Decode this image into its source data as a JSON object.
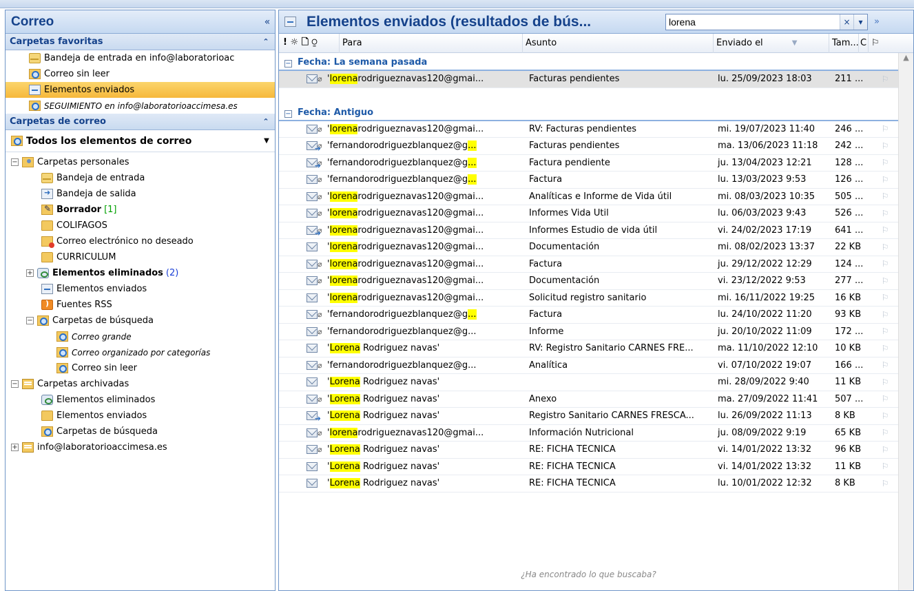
{
  "nav": {
    "title": "Correo",
    "collapse": "«",
    "favorites_header": "Carpetas favoritas",
    "favorites": [
      {
        "label": "Bandeja de entrada en info@laboratorioac",
        "icon": "inbox-icon"
      },
      {
        "label": "Correo sin leer",
        "icon": "search-folder-icon"
      },
      {
        "label": "Elementos enviados",
        "icon": "sent-items-icon",
        "selected": true
      },
      {
        "label": "SEGUIMIENTO en info@laboratorioaccimesa.es",
        "icon": "search-folder-icon",
        "italic": true
      }
    ],
    "mail_header": "Carpetas de correo",
    "all_items": "Todos los elementos de correo",
    "tree": [
      {
        "label": "Carpetas personales",
        "level": 0,
        "expander": "⊟",
        "icon": "personal-folders-icon"
      },
      {
        "label": "Bandeja de entrada",
        "level": 1,
        "icon": "inbox-icon"
      },
      {
        "label": "Bandeja de salida",
        "level": 1,
        "icon": "outbox-icon"
      },
      {
        "label": "Borrador",
        "level": 1,
        "icon": "drafts-icon",
        "bold": true,
        "count": "[1]",
        "count_color": "green"
      },
      {
        "label": "COLIFAGOS",
        "level": 1,
        "icon": "folder-icon"
      },
      {
        "label": "Correo electrónico no deseado",
        "level": 1,
        "icon": "junk-icon"
      },
      {
        "label": "CURRICULUM",
        "level": 1,
        "icon": "folder-icon"
      },
      {
        "label": "Elementos eliminados",
        "level": 1,
        "icon": "deleted-items-icon",
        "bold": true,
        "count": "(2)",
        "count_color": "blue",
        "expander": "⊞"
      },
      {
        "label": "Elementos enviados",
        "level": 1,
        "icon": "sent-items-icon"
      },
      {
        "label": "Fuentes RSS",
        "level": 1,
        "icon": "rss-icon"
      },
      {
        "label": "Carpetas de búsqueda",
        "level": 1,
        "icon": "search-folder-icon",
        "expander": "⊟"
      },
      {
        "label": "Correo grande",
        "level": 2,
        "icon": "search-folder-icon",
        "italic": true
      },
      {
        "label": "Correo organizado por categorías",
        "level": 2,
        "icon": "search-folder-icon",
        "italic": true
      },
      {
        "label": "Correo sin leer",
        "level": 2,
        "icon": "search-folder-icon"
      },
      {
        "label": "Carpetas archivadas",
        "level": 0,
        "expander": "⊟",
        "icon": "archive-folders-icon"
      },
      {
        "label": "Elementos eliminados",
        "level": 1,
        "icon": "deleted-items-icon"
      },
      {
        "label": "Elementos enviados",
        "level": 1,
        "icon": "folder-icon"
      },
      {
        "label": "Carpetas de búsqueda",
        "level": 1,
        "icon": "search-folder-icon"
      },
      {
        "label": "info@laboratorioaccimesa.es",
        "level": 0,
        "expander": "⊞",
        "icon": "archive-folders-icon"
      }
    ]
  },
  "main": {
    "title": "Elementos enviados (resultados de bús...",
    "search_value": "lorena",
    "search_clear": "×",
    "search_dropdown": "▾",
    "more": "»",
    "columns": {
      "icons": "! ☼ 🗋 ⍜",
      "to": "Para",
      "subject": "Asunto",
      "sent": "Enviado el",
      "size": "Tam...",
      "cat": "C",
      "flag": "⚐"
    },
    "groups": [
      {
        "label": "Fecha: La semana pasada",
        "rows": [
          {
            "hl": "lorena",
            "rest": "rodrigueznavas120@gmai...",
            "subject": "Facturas pendientes",
            "date": "lu. 25/09/2023 18:03",
            "size": "211 ...",
            "att": true,
            "fwd": false,
            "selected": true,
            "quote": "'"
          }
        ]
      },
      {
        "label": "Fecha: Antiguo",
        "rows": [
          {
            "hl": "lorena",
            "rest": "rodrigueznavas120@gmai...",
            "subject": "RV: Facturas pendientes",
            "date": "mi. 19/07/2023 11:40",
            "size": "246 ...",
            "att": true,
            "fwd": false,
            "quote": "'"
          },
          {
            "pre": "'fernandorodriguezblanquez@g",
            "hl": "...",
            "rest": "",
            "subject": "Facturas pendientes",
            "date": "ma. 13/06/2023 11:18",
            "size": "242 ...",
            "att": true,
            "fwd": true
          },
          {
            "pre": "'fernandorodriguezblanquez@g",
            "hl": "...",
            "rest": "",
            "subject": "Factura pendiente",
            "date": "ju. 13/04/2023 12:21",
            "size": "128 ...",
            "att": true,
            "fwd": true
          },
          {
            "pre": "'fernandorodriguezblanquez@g",
            "hl": "...",
            "rest": "",
            "subject": "Factura",
            "date": "lu. 13/03/2023 9:53",
            "size": "126 ...",
            "att": true,
            "fwd": false
          },
          {
            "hl": "lorena",
            "rest": "rodrigueznavas120@gmai...",
            "subject": "Analíticas e Informe de Vida útil",
            "date": "mi. 08/03/2023 10:35",
            "size": "505 ...",
            "att": true,
            "fwd": false,
            "quote": "'"
          },
          {
            "hl": "lorena",
            "rest": "rodrigueznavas120@gmai...",
            "subject": "Informes Vida Útil",
            "date": "lu. 06/03/2023 9:43",
            "size": "526 ...",
            "att": true,
            "fwd": false,
            "quote": "'"
          },
          {
            "hl": "lorena",
            "rest": "rodrigueznavas120@gmai...",
            "subject": "Informes Estudio de vida útil",
            "date": "vi. 24/02/2023 17:19",
            "size": "641 ...",
            "att": true,
            "fwd": true,
            "quote": "'"
          },
          {
            "hl": "lorena",
            "rest": "rodrigueznavas120@gmai...",
            "subject": "Documentación",
            "date": "mi. 08/02/2023 13:37",
            "size": "22 KB",
            "att": false,
            "fwd": false,
            "quote": "'"
          },
          {
            "hl": "lorena",
            "rest": "rodrigueznavas120@gmai...",
            "subject": "Factura",
            "date": "ju. 29/12/2022 12:29",
            "size": "124 ...",
            "att": true,
            "fwd": false,
            "quote": "'"
          },
          {
            "hl": "lorena",
            "rest": "rodrigueznavas120@gmai...",
            "subject": "Documentación",
            "date": "vi. 23/12/2022 9:53",
            "size": "277 ...",
            "att": true,
            "fwd": false,
            "quote": "'"
          },
          {
            "hl": "lorena",
            "rest": "rodrigueznavas120@gmai...",
            "subject": "Solicitud registro sanitario",
            "date": "mi. 16/11/2022 19:25",
            "size": "16 KB",
            "att": false,
            "fwd": false,
            "quote": "'"
          },
          {
            "pre": "'fernandorodriguezblanquez@g",
            "hl": "...",
            "rest": "",
            "subject": "Factura",
            "date": "lu. 24/10/2022 11:20",
            "size": "93 KB",
            "att": true,
            "fwd": false
          },
          {
            "pre": "'fernandorodriguezblanquez@g...",
            "hl": "",
            "rest": "",
            "subject": "Informe",
            "date": "ju. 20/10/2022 11:09",
            "size": "172 ...",
            "att": true,
            "fwd": false
          },
          {
            "hl": "Lorena",
            "rest": " Rodriguez navas'",
            "subject": "RV: Registro Sanitario CARNES FRE...",
            "date": "ma. 11/10/2022 12:10",
            "size": "10 KB",
            "att": false,
            "fwd": false,
            "quote": "'"
          },
          {
            "pre": "'fernandorodriguezblanquez@g...",
            "hl": "",
            "rest": "",
            "subject": "Analítica",
            "date": "vi. 07/10/2022 19:07",
            "size": "166 ...",
            "att": true,
            "fwd": false
          },
          {
            "hl": "Lorena",
            "rest": " Rodriguez navas'",
            "subject": "",
            "date": "mi. 28/09/2022 9:40",
            "size": "11 KB",
            "att": false,
            "fwd": false,
            "quote": "'"
          },
          {
            "hl": "Lorena",
            "rest": " Rodriguez navas'",
            "subject": "Anexo",
            "date": "ma. 27/09/2022 11:41",
            "size": "507 ...",
            "att": true,
            "fwd": false,
            "quote": "'"
          },
          {
            "hl": "Lorena",
            "rest": " Rodriguez navas'",
            "subject": "Registro Sanitario CARNES FRESCA...",
            "date": "lu. 26/09/2022 11:13",
            "size": "8 KB",
            "att": false,
            "fwd": true,
            "quote": "'"
          },
          {
            "hl": "lorena",
            "rest": "rodrigueznavas120@gmai...",
            "subject": "Información Nutricional",
            "date": "ju. 08/09/2022 9:19",
            "size": "65 KB",
            "att": true,
            "fwd": false,
            "quote": "'"
          },
          {
            "hl": "Lorena",
            "rest": " Rodriguez navas'",
            "subject": "RE: FICHA TÉCNICA",
            "date": "vi. 14/01/2022 13:32",
            "size": "96 KB",
            "att": true,
            "fwd": false,
            "quote": "'"
          },
          {
            "hl": "Lorena",
            "rest": " Rodriguez navas'",
            "subject": "RE: FICHA TÉCNICA",
            "date": "vi. 14/01/2022 13:32",
            "size": "11 KB",
            "att": false,
            "fwd": false,
            "quote": "'"
          },
          {
            "hl": "Lorena",
            "rest": " Rodriguez navas'",
            "subject": "RE: FICHA TÉCNICA",
            "date": "lu. 10/01/2022 12:32",
            "size": "8 KB",
            "att": false,
            "fwd": false,
            "quote": "'"
          }
        ]
      }
    ],
    "footer": "¿Ha encontrado lo que buscaba?"
  },
  "colors": {
    "accent": "#15428b",
    "selection": "#f6b83b",
    "highlight": "#ffff00"
  }
}
